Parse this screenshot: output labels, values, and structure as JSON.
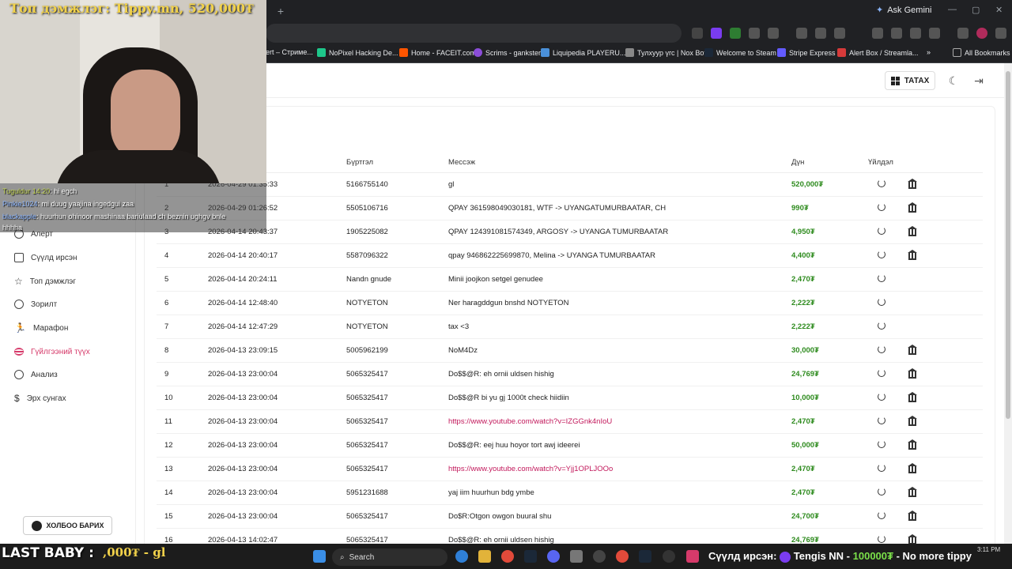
{
  "browser": {
    "ask_gemini": "Ask Gemini",
    "bookmarks": [
      "ert – Стриме...",
      "NoPixel Hacking De...",
      "Home - FACEIT.com",
      "Scrims - gankster",
      "Liquipedia PLAYERU...",
      "Тулхуур үгс | Nox Bot",
      "Welcome to Steam",
      "Stripe Express",
      "Alert Box / Streamla..."
    ],
    "all_bookmarks": "All Bookmarks"
  },
  "header": {
    "download_label": "ТАТАХ"
  },
  "sidebar": {
    "items": [
      {
        "label": "Алерт",
        "active": false
      },
      {
        "label": "Сүүлд ирсэн",
        "active": false
      },
      {
        "label": "Топ дэмжлэг",
        "active": false
      },
      {
        "label": "Зорилт",
        "active": false
      },
      {
        "label": "Марафон",
        "active": false
      },
      {
        "label": "Гүйлгээний түүх",
        "active": true
      },
      {
        "label": "Анализ",
        "active": false
      },
      {
        "label": "Эрх сунгах",
        "active": false
      }
    ],
    "contact_label": "ХОЛБОО БАРИХ"
  },
  "table": {
    "headers": {
      "reg": "Бүртгэл",
      "msg": "Мессэж",
      "amount": "Дүн",
      "action": "Үйлдэл"
    },
    "rows": [
      {
        "n": "1",
        "date": "2026-04-29 01:35:33",
        "reg": "5166755140",
        "msg": "gl",
        "amount": "520,000₮",
        "bank": true,
        "link": false
      },
      {
        "n": "2",
        "date": "2026-04-29 01:26:52",
        "reg": "5505106716",
        "msg": "QPAY 361598049030181, WTF -> UYANGATUMURBAATAR, CH",
        "amount": "990₮",
        "bank": true,
        "link": false
      },
      {
        "n": "3",
        "date": "2026-04-14 20:43:37",
        "reg": "1905225082",
        "msg": "QPAY 124391081574349, ARGOSY -> UYANGA TUMURBAATAR",
        "amount": "4,950₮",
        "bank": true,
        "link": false
      },
      {
        "n": "4",
        "date": "2026-04-14 20:40:17",
        "reg": "5587096322",
        "msg": "qpay 946862225699870, Melina -> UYANGA TUMURBAATAR",
        "amount": "4,400₮",
        "bank": true,
        "link": false
      },
      {
        "n": "5",
        "date": "2026-04-14 20:24:11",
        "reg": "Nandn gnude",
        "msg": "Minii joojkon setgel genudee",
        "amount": "2,470₮",
        "bank": false,
        "link": false
      },
      {
        "n": "6",
        "date": "2026-04-14 12:48:40",
        "reg": "NOTYETON",
        "msg": "Ner haragddgun bnshd NOTYETON",
        "amount": "2,222₮",
        "bank": false,
        "link": false
      },
      {
        "n": "7",
        "date": "2026-04-14 12:47:29",
        "reg": "NOTYETON",
        "msg": "tax <3",
        "amount": "2,222₮",
        "bank": false,
        "link": false
      },
      {
        "n": "8",
        "date": "2026-04-13 23:09:15",
        "reg": "5005962199",
        "msg": "NoM4Dz",
        "amount": "30,000₮",
        "bank": true,
        "link": false
      },
      {
        "n": "9",
        "date": "2026-04-13 23:00:04",
        "reg": "5065325417",
        "msg": "Do$$@R: eh ornii uldsen hishig",
        "amount": "24,769₮",
        "bank": true,
        "link": false
      },
      {
        "n": "10",
        "date": "2026-04-13 23:00:04",
        "reg": "5065325417",
        "msg": "Do$$@R bi yu gj 1000t check hiidiin",
        "amount": "10,000₮",
        "bank": true,
        "link": false
      },
      {
        "n": "11",
        "date": "2026-04-13 23:00:04",
        "reg": "5065325417",
        "msg": "https://www.youtube.com/watch?v=IZGGnk4nIoU",
        "amount": "2,470₮",
        "bank": true,
        "link": true
      },
      {
        "n": "12",
        "date": "2026-04-13 23:00:04",
        "reg": "5065325417",
        "msg": "Do$$@R: eej huu hoyor tort awj ideerei",
        "amount": "50,000₮",
        "bank": true,
        "link": false
      },
      {
        "n": "13",
        "date": "2026-04-13 23:00:04",
        "reg": "5065325417",
        "msg": "https://www.youtube.com/watch?v=Yjj1OPLJOOo",
        "amount": "2,470₮",
        "bank": true,
        "link": true
      },
      {
        "n": "14",
        "date": "2026-04-13 23:00:04",
        "reg": "5951231688",
        "msg": "yaj iim huurhun bdg ymbe",
        "amount": "2,470₮",
        "bank": true,
        "link": false
      },
      {
        "n": "15",
        "date": "2026-04-13 23:00:04",
        "reg": "5065325417",
        "msg": "Do$R:Otgon owgon buural shu",
        "amount": "24,700₮",
        "bank": true,
        "link": false
      },
      {
        "n": "16",
        "date": "2026-04-13 14:02:47",
        "reg": "5065325417",
        "msg": "Do$$@R: eh ornii uldsen hishig",
        "amount": "24,769₮",
        "bank": true,
        "link": false
      }
    ]
  },
  "stream": {
    "title": "Топ дэмжлэг: Tippy.mn, 520,000₮",
    "chat": [
      {
        "user": "Tuguldur 14:20",
        "text": ": hi egch"
      },
      {
        "user": "Pinkie1024",
        "text": ": mi duug yaajina ingedgui zaa"
      },
      {
        "user": "blackapple",
        "text": ": huurhun ohinoor mashinaa bariulaad ch beznin ughgv bnle"
      },
      {
        "user": "",
        "text": "hhhha"
      }
    ],
    "last_label": "LAST BABY :",
    "last_amount": ",000₮ - gl",
    "ticker_prefix": "Сүүлд ирсэн:",
    "ticker_name": "Tengis NN -",
    "ticker_amount": "100000₮",
    "ticker_msg": "- No more tippy"
  },
  "taskbar": {
    "search": "Search",
    "time": "3:11 PM"
  }
}
